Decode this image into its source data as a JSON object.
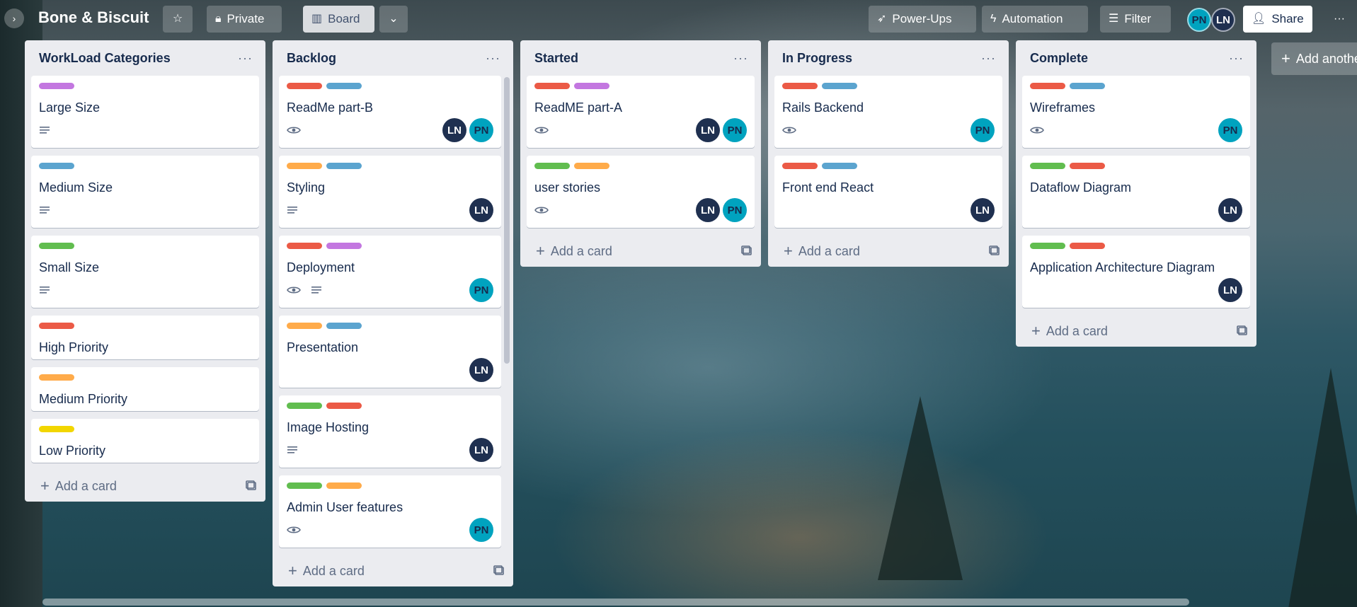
{
  "header": {
    "board_title": "Bone & Biscuit",
    "visibility": "Private",
    "view": "Board",
    "power_ups": "Power-Ups",
    "automation": "Automation",
    "filter": "Filter",
    "members": [
      "PN",
      "LN"
    ],
    "share": "Share"
  },
  "colors": {
    "red": "#eb5a46",
    "blue": "#0079bf",
    "sky": "#5ba4cf",
    "green": "#61bd4f",
    "orange": "#ffab4a",
    "purple": "#c377e0",
    "yellow": "#f2d600",
    "pn": "#00a3bf",
    "ln": "#1f3050"
  },
  "add_card_label": "Add a card",
  "add_list_label": "Add another list",
  "lists": [
    {
      "title": "WorkLoad Categories",
      "cards": [
        {
          "title": "Large Size",
          "labels": [
            "purple"
          ],
          "badges": [
            "description"
          ],
          "members": []
        },
        {
          "title": "Medium Size",
          "labels": [
            "sky"
          ],
          "badges": [
            "description"
          ],
          "members": []
        },
        {
          "title": "Small Size",
          "labels": [
            "green"
          ],
          "badges": [
            "description"
          ],
          "members": []
        },
        {
          "title": "High Priority",
          "labels": [
            "red"
          ],
          "badges": [],
          "members": []
        },
        {
          "title": "Medium Priority",
          "labels": [
            "orange"
          ],
          "badges": [],
          "members": []
        },
        {
          "title": "Low Priority",
          "labels": [
            "yellow"
          ],
          "badges": [],
          "members": []
        }
      ]
    },
    {
      "title": "Backlog",
      "cards": [
        {
          "title": "ReadMe part-B",
          "labels": [
            "red",
            "sky"
          ],
          "badges": [
            "watch"
          ],
          "members": [
            "LN",
            "PN"
          ]
        },
        {
          "title": "Styling",
          "labels": [
            "orange",
            "sky"
          ],
          "badges": [
            "description"
          ],
          "members": [
            "LN"
          ]
        },
        {
          "title": "Deployment",
          "labels": [
            "red",
            "purple"
          ],
          "badges": [
            "watch",
            "description"
          ],
          "members": [
            "PN"
          ]
        },
        {
          "title": "Presentation",
          "labels": [
            "orange",
            "sky"
          ],
          "badges": [],
          "members": [
            "LN"
          ]
        },
        {
          "title": "Image Hosting",
          "labels": [
            "green",
            "red"
          ],
          "badges": [
            "description"
          ],
          "members": [
            "LN"
          ]
        },
        {
          "title": "Admin User features",
          "labels": [
            "green",
            "orange"
          ],
          "badges": [
            "watch"
          ],
          "members": [
            "PN"
          ]
        }
      ]
    },
    {
      "title": "Started",
      "cards": [
        {
          "title": "ReadME part-A",
          "labels": [
            "red",
            "purple"
          ],
          "badges": [
            "watch"
          ],
          "members": [
            "LN",
            "PN"
          ]
        },
        {
          "title": "user stories",
          "labels": [
            "green",
            "orange"
          ],
          "badges": [
            "watch"
          ],
          "members": [
            "LN",
            "PN"
          ]
        }
      ]
    },
    {
      "title": "In Progress",
      "cards": [
        {
          "title": "Rails Backend",
          "labels": [
            "red",
            "sky"
          ],
          "badges": [
            "watch"
          ],
          "members": [
            "PN"
          ]
        },
        {
          "title": "Front end React",
          "labels": [
            "red",
            "sky"
          ],
          "badges": [],
          "members": [
            "LN"
          ]
        }
      ]
    },
    {
      "title": "Complete",
      "cards": [
        {
          "title": "Wireframes",
          "labels": [
            "red",
            "sky"
          ],
          "badges": [
            "watch"
          ],
          "members": [
            "PN"
          ]
        },
        {
          "title": "Dataflow Diagram",
          "labels": [
            "green",
            "red"
          ],
          "badges": [],
          "members": [
            "LN"
          ]
        },
        {
          "title": "Application Architecture Diagram",
          "labels": [
            "green",
            "red"
          ],
          "badges": [],
          "members": [
            "LN"
          ]
        }
      ]
    }
  ]
}
